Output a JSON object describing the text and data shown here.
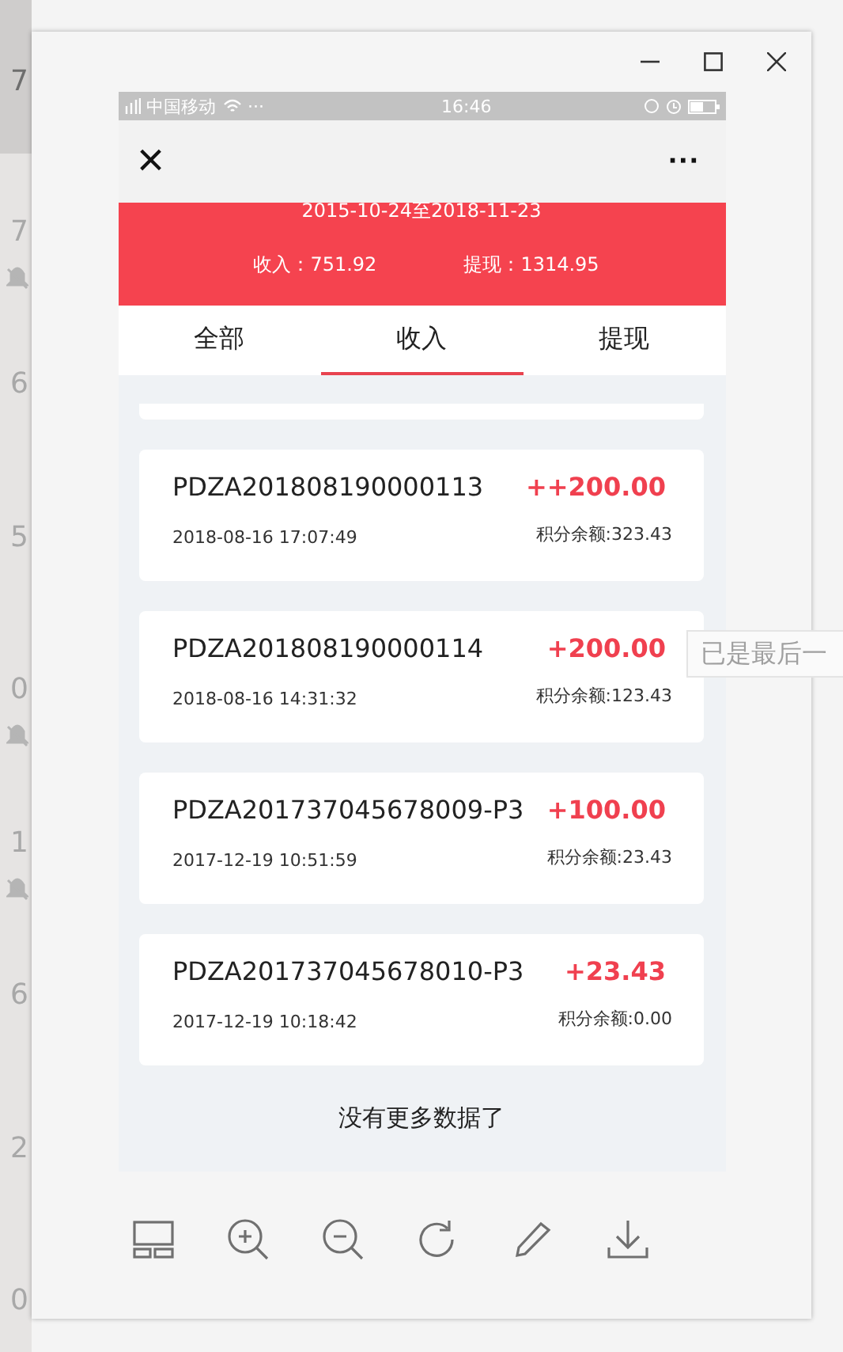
{
  "background_list": [
    {
      "text": "7",
      "muted": false,
      "selected": true
    },
    {
      "text": "7",
      "muted": true,
      "selected": false
    },
    {
      "text": "6",
      "muted": false,
      "selected": false
    },
    {
      "text": "5",
      "muted": false,
      "selected": false
    },
    {
      "text": "0",
      "muted": true,
      "selected": false
    },
    {
      "text": "1",
      "muted": true,
      "selected": false
    },
    {
      "text": "6",
      "muted": false,
      "selected": false
    },
    {
      "text": "2",
      "muted": false,
      "selected": false
    },
    {
      "text": "0",
      "muted": false,
      "selected": false
    }
  ],
  "status_bar": {
    "carrier": "中国移动",
    "dots": "···",
    "time": "16:46"
  },
  "nav": {
    "close": "×",
    "more": "···"
  },
  "header": {
    "range": "2015-10-24至2018-11-23",
    "income": "收入：751.92",
    "withdraw": "提现：1314.95"
  },
  "tabs": [
    {
      "label": "全部",
      "selected": false
    },
    {
      "label": "收入",
      "selected": true
    },
    {
      "label": "提现",
      "selected": false
    }
  ],
  "records": [
    {
      "id": "PDZA201808190000113",
      "amount": "++200.00",
      "date": "2018-08-16 17:07:49",
      "balance": "积分余额:323.43"
    },
    {
      "id": "PDZA201808190000114",
      "amount": "+200.00",
      "date": "2018-08-16 14:31:32",
      "balance": "积分余额:123.43"
    },
    {
      "id": "PDZA201737045678009-P3",
      "amount": "+100.00",
      "date": "2017-12-19 10:51:59",
      "balance": "积分余额:23.43"
    },
    {
      "id": "PDZA201737045678010-P3",
      "amount": "+23.43",
      "date": "2017-12-19 10:18:42",
      "balance": "积分余额:0.00"
    }
  ],
  "end_note": "没有更多数据了",
  "tooltip": "已是最后一"
}
